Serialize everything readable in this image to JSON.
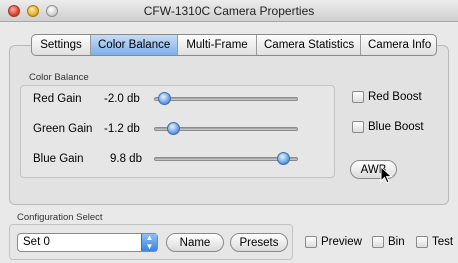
{
  "window": {
    "title": "CFW-1310C Camera Properties"
  },
  "tabs": [
    {
      "label": "Settings",
      "active": false
    },
    {
      "label": "Color Balance",
      "active": true
    },
    {
      "label": "Multi-Frame",
      "active": false
    },
    {
      "label": "Camera Statistics",
      "active": false
    },
    {
      "label": "Camera Info",
      "active": false
    }
  ],
  "color_balance": {
    "group_label": "Color Balance",
    "rows": [
      {
        "label": "Red Gain",
        "value": "-2.0 db",
        "slider_fraction": 0.03
      },
      {
        "label": "Green Gain",
        "value": "-1.2 db",
        "slider_fraction": 0.1
      },
      {
        "label": "Blue Gain",
        "value": "9.8 db",
        "slider_fraction": 0.94
      }
    ],
    "red_boost_label": "Red Boost",
    "blue_boost_label": "Blue Boost",
    "awb_label": "AWB"
  },
  "configuration": {
    "group_label": "Configuration Select",
    "selected": "Set 0",
    "name_label": "Name",
    "presets_label": "Presets"
  },
  "bottom": {
    "preview_label": "Preview",
    "bin_label": "Bin",
    "test_label": "Test"
  },
  "colors": {
    "accent": "#5a9be6",
    "window_bg": "#e9e9e9"
  }
}
